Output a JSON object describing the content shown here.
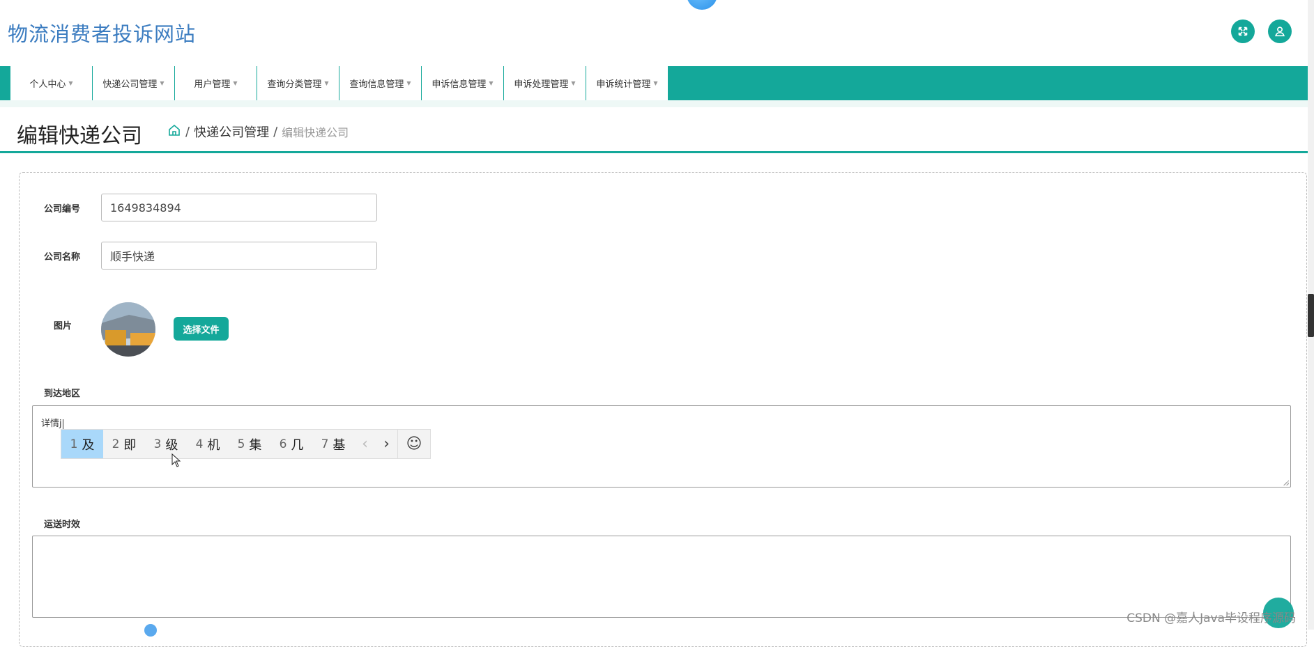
{
  "header": {
    "site_title": "物流消费者投诉网站",
    "icons": [
      "fullscreen-icon",
      "user-icon"
    ]
  },
  "nav": {
    "tabs": [
      {
        "label": "个人中心"
      },
      {
        "label": "快递公司管理"
      },
      {
        "label": "用户管理"
      },
      {
        "label": "查询分类管理"
      },
      {
        "label": "查询信息管理"
      },
      {
        "label": "申诉信息管理"
      },
      {
        "label": "申诉处理管理"
      },
      {
        "label": "申诉统计管理"
      }
    ]
  },
  "page": {
    "title": "编辑快递公司",
    "breadcrumb": {
      "sep": "/",
      "section": "快递公司管理",
      "current": "编辑快递公司"
    }
  },
  "form": {
    "company_no": {
      "label": "公司编号",
      "value": "1649834894"
    },
    "company_name": {
      "label": "公司名称",
      "value": "顺手快递"
    },
    "image": {
      "label": "图片",
      "button": "选择文件"
    },
    "area": {
      "label": "到达地区",
      "value": "详情j"
    },
    "delivery_time": {
      "label": "运送时效",
      "value": ""
    }
  },
  "ime": {
    "candidates": [
      {
        "n": "1",
        "c": "及",
        "selected": true
      },
      {
        "n": "2",
        "c": "即"
      },
      {
        "n": "3",
        "c": "级"
      },
      {
        "n": "4",
        "c": "机"
      },
      {
        "n": "5",
        "c": "集"
      },
      {
        "n": "6",
        "c": "几"
      },
      {
        "n": "7",
        "c": "基"
      }
    ],
    "prev": "‹",
    "next": "›",
    "emoji": "☺"
  },
  "watermark": "CSDN @嘉人Java毕设程序源码",
  "colors": {
    "accent": "#14a89a",
    "title": "#3b7cc0"
  }
}
